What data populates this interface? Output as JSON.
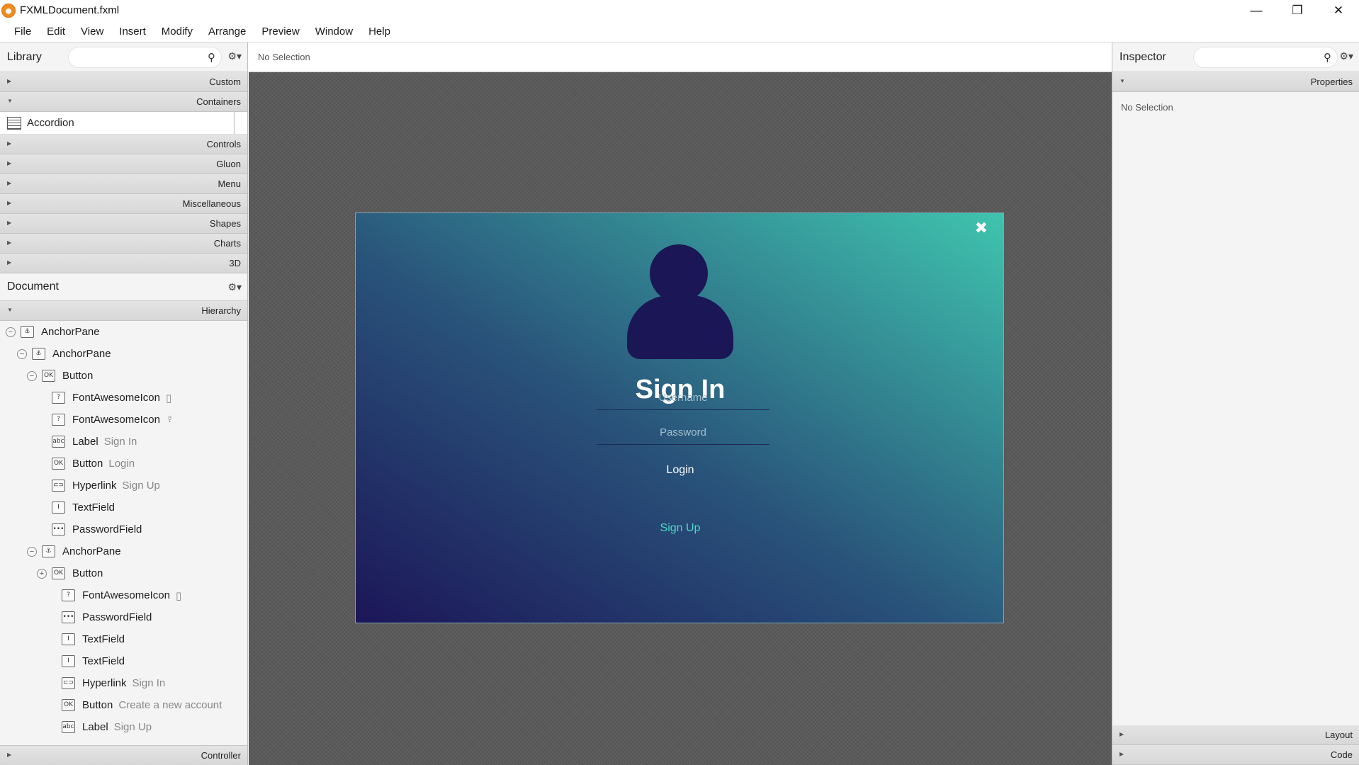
{
  "window": {
    "title": "FXMLDocument.fxml",
    "minimize": "—",
    "maximize": "❐",
    "close": "✕"
  },
  "menu": [
    "File",
    "Edit",
    "View",
    "Insert",
    "Modify",
    "Arrange",
    "Preview",
    "Window",
    "Help"
  ],
  "library": {
    "title": "Library",
    "sections_top": [
      "Custom",
      "Containers"
    ],
    "container_item": "Accordion",
    "sections_rest": [
      "Controls",
      "Gluon",
      "Menu",
      "Miscellaneous",
      "Shapes",
      "Charts",
      "3D"
    ]
  },
  "document": {
    "title": "Document",
    "hierarchy_label": "Hierarchy",
    "tree": [
      {
        "icon": "anchor",
        "type": "AnchorPane",
        "sub": "",
        "exp": "−"
      },
      {
        "icon": "anchor",
        "type": "AnchorPane",
        "sub": "",
        "exp": "−"
      },
      {
        "icon": "ok",
        "type": "Button",
        "sub": "",
        "exp": "−"
      },
      {
        "icon": "unknown",
        "type": "FontAwesomeIcon",
        "sub": "▯",
        "exp": ""
      },
      {
        "icon": "unknown",
        "type": "FontAwesomeIcon",
        "sub": "☿",
        "exp": ""
      },
      {
        "icon": "abc",
        "type": "Label",
        "sub": "Sign In",
        "exp": ""
      },
      {
        "icon": "ok",
        "type": "Button",
        "sub": "Login",
        "exp": ""
      },
      {
        "icon": "link",
        "type": "Hyperlink",
        "sub": "Sign Up",
        "exp": ""
      },
      {
        "icon": "text",
        "type": "TextField",
        "sub": "",
        "exp": ""
      },
      {
        "icon": "pass",
        "type": "PasswordField",
        "sub": "",
        "exp": ""
      },
      {
        "icon": "anchor",
        "type": "AnchorPane",
        "sub": "",
        "exp": "−"
      },
      {
        "icon": "ok",
        "type": "Button",
        "sub": "",
        "exp": "+"
      },
      {
        "icon": "unknown",
        "type": "FontAwesomeIcon",
        "sub": "▯",
        "exp": ""
      },
      {
        "icon": "pass",
        "type": "PasswordField",
        "sub": "",
        "exp": ""
      },
      {
        "icon": "text",
        "type": "TextField",
        "sub": "",
        "exp": ""
      },
      {
        "icon": "text",
        "type": "TextField",
        "sub": "",
        "exp": ""
      },
      {
        "icon": "link",
        "type": "Hyperlink",
        "sub": "Sign In",
        "exp": ""
      },
      {
        "icon": "ok",
        "type": "Button",
        "sub": "Create a new account",
        "exp": ""
      },
      {
        "icon": "abc",
        "type": "Label",
        "sub": "Sign Up",
        "exp": ""
      }
    ],
    "controller_label": "Controller"
  },
  "canvas": {
    "selection_status": "No Selection",
    "form": {
      "close_icon": "✖",
      "title": "Sign In",
      "username_placeholder": "Username",
      "password_placeholder": "Password",
      "login_label": "Login",
      "signup_label": "Sign Up"
    }
  },
  "inspector": {
    "title": "Inspector",
    "properties_label": "Properties",
    "empty_text": "No Selection",
    "layout_label": "Layout",
    "code_label": "Code"
  },
  "colors": {
    "accent": "#3fc4ae",
    "form_dark": "#1c1658",
    "avatar": "#1b1756",
    "link": "#4ed8c8"
  }
}
